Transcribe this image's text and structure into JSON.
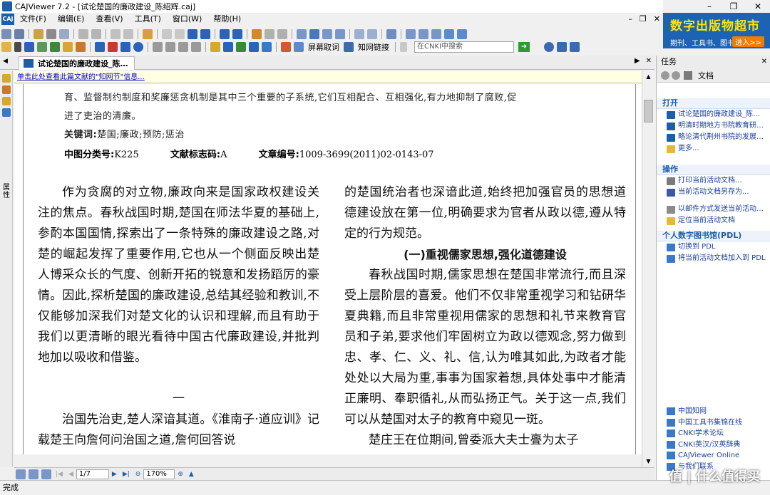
{
  "window": {
    "title": "CAJViewer 7.2 - [试论楚国的廉政建设_陈绍辉.caj]",
    "buttons": [
      "–",
      "❐",
      "✕"
    ]
  },
  "menu": {
    "items": [
      "文件(F)",
      "编辑(E)",
      "查看(V)",
      "工具(T)",
      "窗口(W)",
      "帮助(H)"
    ],
    "mdi_controls": [
      "–",
      "❐",
      "✕"
    ]
  },
  "ad": {
    "headline": "数字出版物超市",
    "sub": "期刊、工具书、图书…",
    "enter": "进入>>"
  },
  "toolbar": {
    "screen_capture": "屏幕取词",
    "word_link": "知网链接",
    "search_placeholder": "在CNKI中搜索"
  },
  "tab": {
    "label": "试论楚国的廉政建设_陈…",
    "left_arrow": "◀",
    "right_ctrls": [
      "▶",
      "✕"
    ]
  },
  "left_strip": {
    "vertical_label": "属性"
  },
  "infobar": {
    "text": "单击此处查看此篇文献的\"知网节\"信息..."
  },
  "document": {
    "abstract_line1": "育、监督制约制度和奖廉惩贪机制是其中三个重要的子系统,它们互相配合、互相强化,有力地抑制了腐败,促",
    "abstract_line2": "进了吏治的清廉。",
    "keywords_label": "关键词:",
    "keywords": "楚国;廉政;预防;惩治",
    "clc_label": "中图分类号:",
    "clc": "K225",
    "doc_code_label": "文献标志码:",
    "doc_code": "A",
    "article_no_label": "文章编号:",
    "article_no": "1009-3699(2011)02-0143-07",
    "left_para": "作为贪腐的对立物,廉政向来是国家政权建设关注的焦点。春秋战国时期,楚国在师法华夏的基础上,参酌本国国情,探索出了一条特殊的廉政建设之路,对楚的崛起发挥了重要作用,它也从一个侧面反映出楚人博采众长的气度、创新开拓的锐意和发扬蹈厉的豪情。因此,探析楚国的廉政建设,总结其经验和教训,不仅能够加深我们对楚文化的认识和理解,而且有助于我们以更清晰的眼光看待中国古代廉政建设,并批判地加以吸收和借鉴。",
    "section_num": "一",
    "left_para2": "治国先治吏,楚人深谙其道。《淮南子·道应训》记载楚王向詹何问治国之道,詹何回答说",
    "right_para1": "的楚国统治者也深谙此道,始终把加强官员的思想道德建设放在第一位,明确要求为官者从政以德,遵从特定的行为规范。",
    "right_heading": "(一)重视儒家思想,强化道德建设",
    "right_para2": "春秋战国时期,儒家思想在楚国非常流行,而且深受上层阶层的喜爱。他们不仅非常重视学习和钻研华夏典籍,而且非常重视用儒家的思想和礼节来教育官员和子弟,要求他们牢固树立为政以德观念,努力做到忠、孝、仁、义、礼、信,认为唯其如此,为政者才能处处以大局为重,事事为国家着想,具体处事中才能清正廉明、奉职循礼,从而弘扬正气。关于这一点,我们可以从楚国对太子的教育中窥见一斑。",
    "right_para3": "楚庄王在位期间,曾委派大夫士亹为太子"
  },
  "nav": {
    "page": "1/7",
    "zoom": "170%"
  },
  "task": {
    "title": "任务",
    "close": "✕",
    "nav_label": "文档",
    "open_header": "打开",
    "open_items": [
      "试论楚国的廉政建设_陈…",
      "明清时期地方书院教育研…",
      "略论清代荆州书院的发展…",
      "更多..."
    ],
    "ops_header": "操作",
    "ops_items": [
      "打印当前活动文档...",
      "当前活动文档另存为...",
      "以邮件方式发送当前活动…",
      "定位当前活动文档"
    ],
    "pdl_header": "个人数字图书馆(PDL)",
    "pdl_items": [
      "切换到 PDL",
      "将当前活动文档加入到 PDL"
    ],
    "links": [
      "中国知网",
      "中国工具书集锦在线",
      "CNKI学术论坛",
      "CNKI英汉/汉英辞典",
      "CAJViewer Online",
      "与我们联系"
    ]
  },
  "status": {
    "text": "完成"
  },
  "watermark": "值 | 什么值得买"
}
